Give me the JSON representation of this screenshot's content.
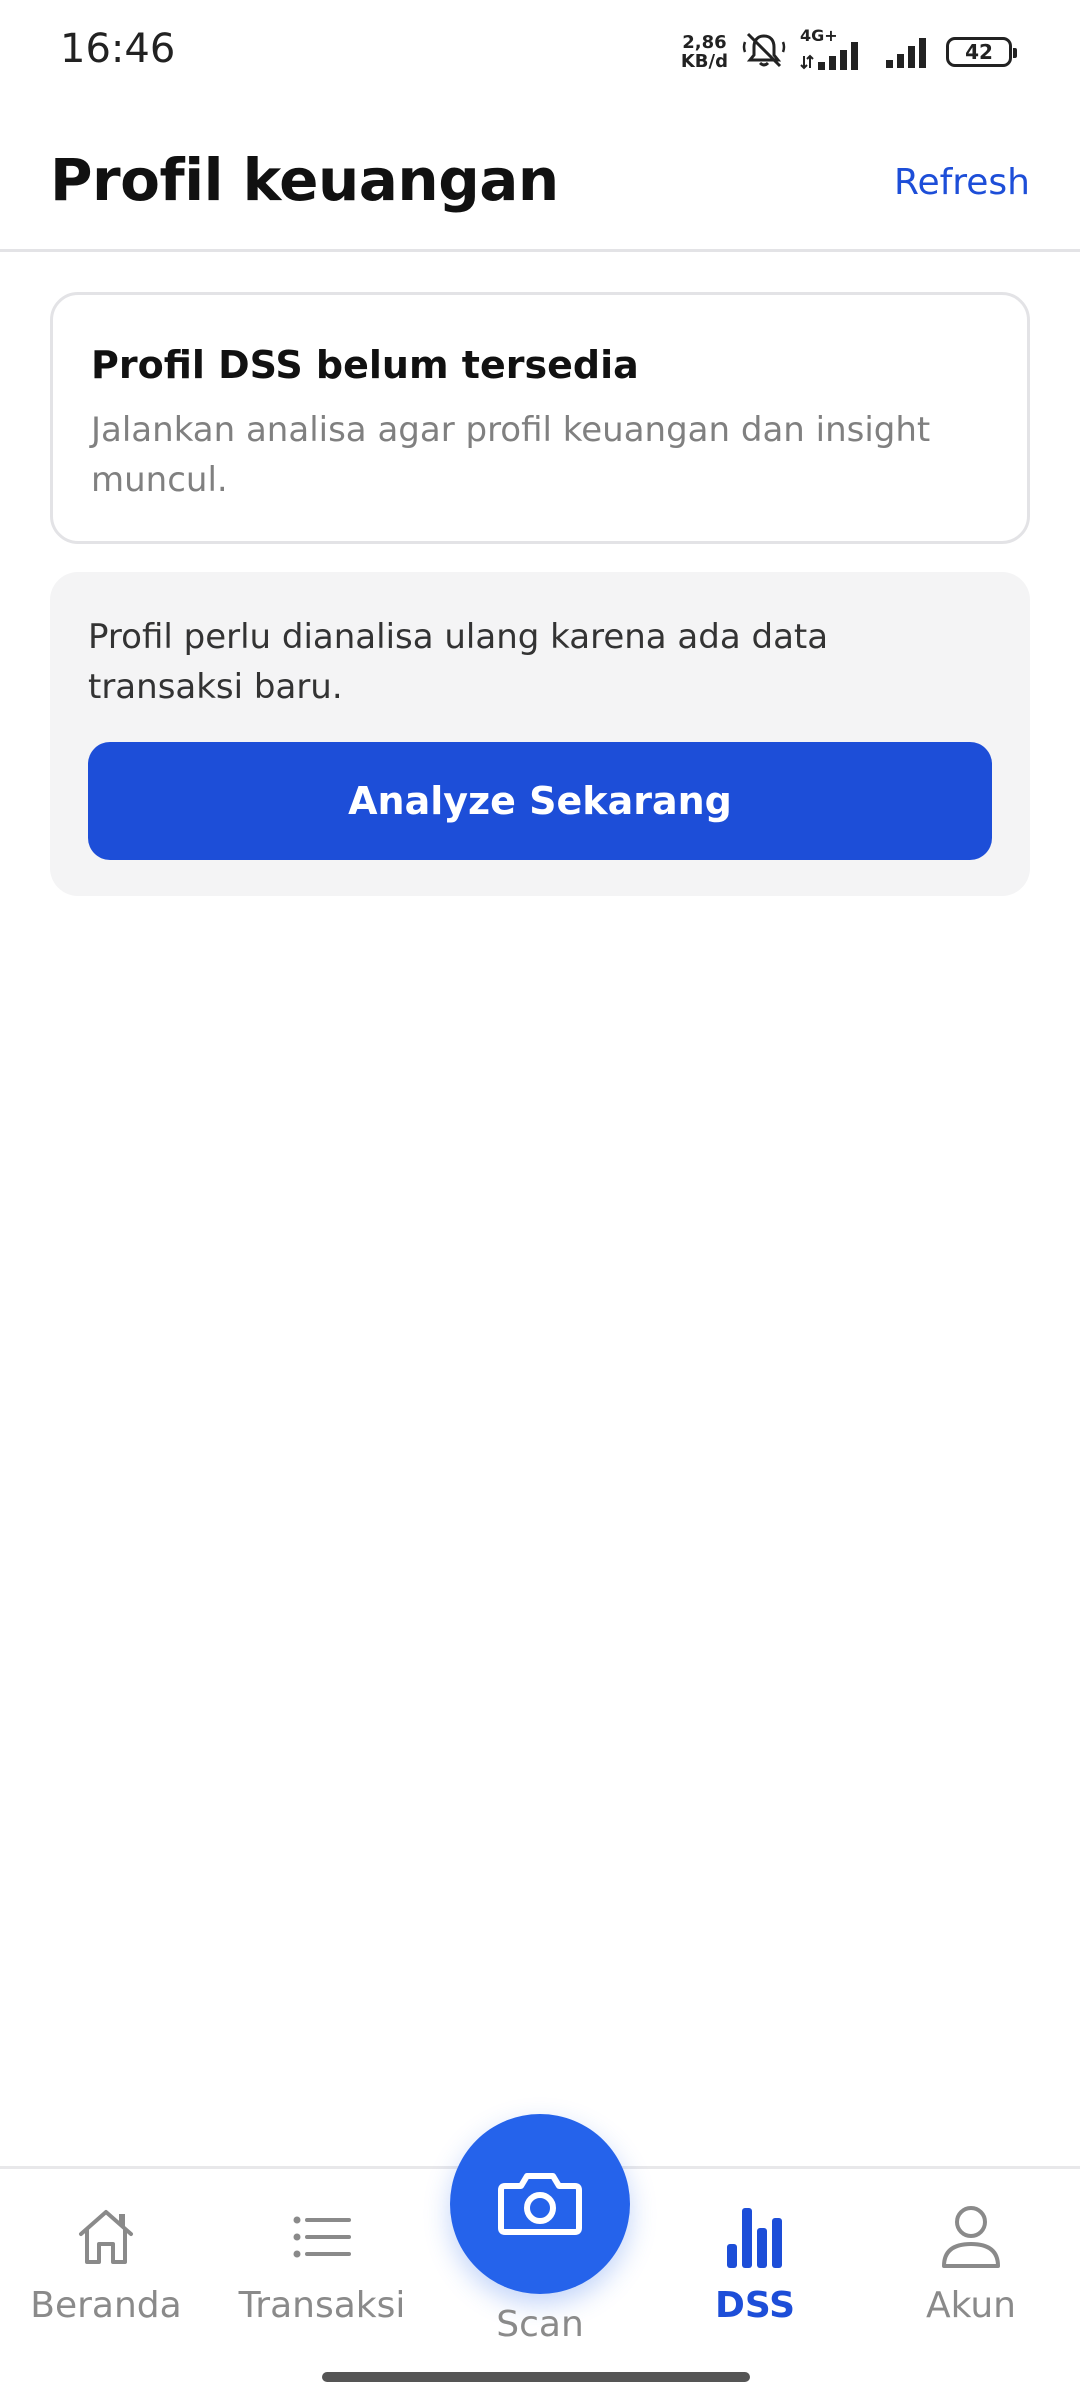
{
  "status_bar": {
    "time": "16:46",
    "net_speed_value": "2,86",
    "net_speed_unit": "KB/d",
    "network_type": "4G+",
    "battery": "42"
  },
  "header": {
    "title": "Profil keuangan",
    "refresh_label": "Refresh"
  },
  "info_card": {
    "title": "Profil DSS belum tersedia",
    "description": "Jalankan analisa agar profil keuangan dan insight muncul."
  },
  "alert_card": {
    "message": "Profil perlu dianalisa ulang karena ada data transaksi baru.",
    "button_label": "Analyze Sekarang"
  },
  "bottom_nav": {
    "items": [
      {
        "label": "Beranda",
        "icon": "home-icon"
      },
      {
        "label": "Transaksi",
        "icon": "list-icon"
      },
      {
        "label": "Scan",
        "icon": "camera-icon"
      },
      {
        "label": "DSS",
        "icon": "bar-chart-icon",
        "active": true
      },
      {
        "label": "Akun",
        "icon": "user-icon"
      }
    ]
  },
  "colors": {
    "primary": "#1d4ed8",
    "fab": "#2563eb",
    "muted_text": "#808080",
    "card_gray": "#f4f4f5"
  }
}
